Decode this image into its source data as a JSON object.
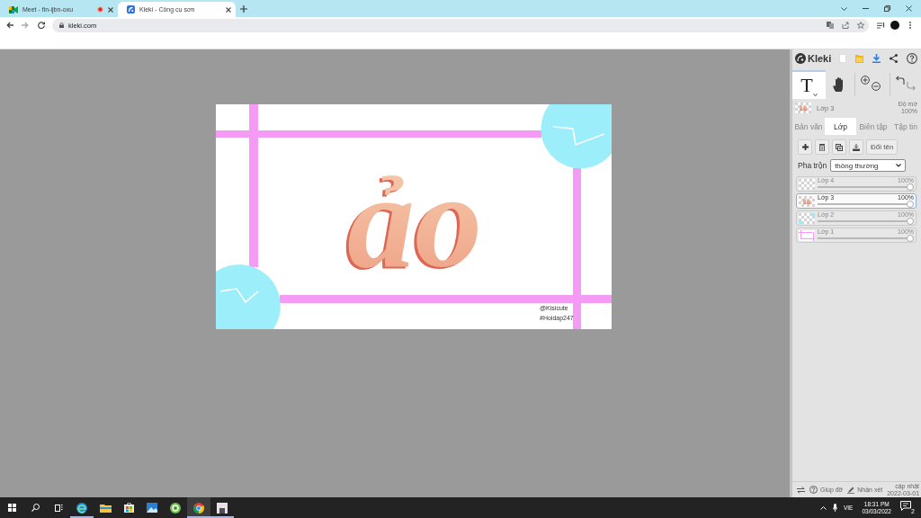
{
  "browser": {
    "tabs": [
      {
        "title": "Meet - fin-ijbn-oxu",
        "selected": false,
        "recording": true
      },
      {
        "title": "Kleki - Công cụ sơn",
        "selected": true,
        "recording": false
      }
    ],
    "url": "kleki.com"
  },
  "canvas": {
    "lettering": "ảo",
    "signature": "@Kisicute",
    "hashtag": "#Hoidap247"
  },
  "panel": {
    "logo": "Kleki",
    "tools": [
      {
        "kind": "text",
        "glyph": "T",
        "selected": true
      },
      {
        "kind": "hand",
        "selected": false
      }
    ],
    "current_layer": {
      "name": "Lớp 3",
      "opacity_label": "Độ mờ",
      "opacity": "100%"
    },
    "tabs": [
      {
        "label": "Bản văn",
        "selected": false
      },
      {
        "label": "Lớp",
        "selected": true
      },
      {
        "label": "Biên tập",
        "selected": false
      },
      {
        "label": "Tập tin",
        "selected": false
      }
    ],
    "layer_actions": [
      {
        "kind": "add"
      },
      {
        "kind": "delete"
      },
      {
        "kind": "duplicate"
      },
      {
        "kind": "merge"
      },
      {
        "kind": "rename",
        "label": "Đổi tên"
      }
    ],
    "blend": {
      "label": "Pha trộn",
      "value": "thông thường"
    },
    "layers": [
      {
        "name": "Lớp 4",
        "opacity": "100%",
        "level": 1,
        "selected": false
      },
      {
        "name": "Lớp 3",
        "opacity": "100%",
        "level": 1,
        "selected": true
      },
      {
        "name": "Lớp 2",
        "opacity": "100%",
        "level": 1,
        "selected": false
      },
      {
        "name": "Lớp 1",
        "opacity": "100%",
        "level": 1,
        "selected": false
      }
    ],
    "footer": {
      "help": "Giúp đỡ",
      "feedback": "Nhận xét",
      "update_label": "cập nhật",
      "update_date": "2022-03-01"
    }
  },
  "taskbar": {
    "apps": [
      {
        "kind": "swirl",
        "selected": false,
        "running": true
      },
      {
        "kind": "folder",
        "selected": false,
        "running": false
      },
      {
        "kind": "bag",
        "selected": false,
        "running": false
      },
      {
        "kind": "landscape",
        "selected": false,
        "running": false
      },
      {
        "kind": "ring",
        "selected": false,
        "running": false
      },
      {
        "kind": "wheel",
        "selected": true,
        "running": true
      },
      {
        "kind": "picture",
        "selected": false,
        "running": true
      }
    ],
    "language": "VIE",
    "time": "18:31 PM",
    "date": "03/03/2022",
    "notifications": "2"
  }
}
